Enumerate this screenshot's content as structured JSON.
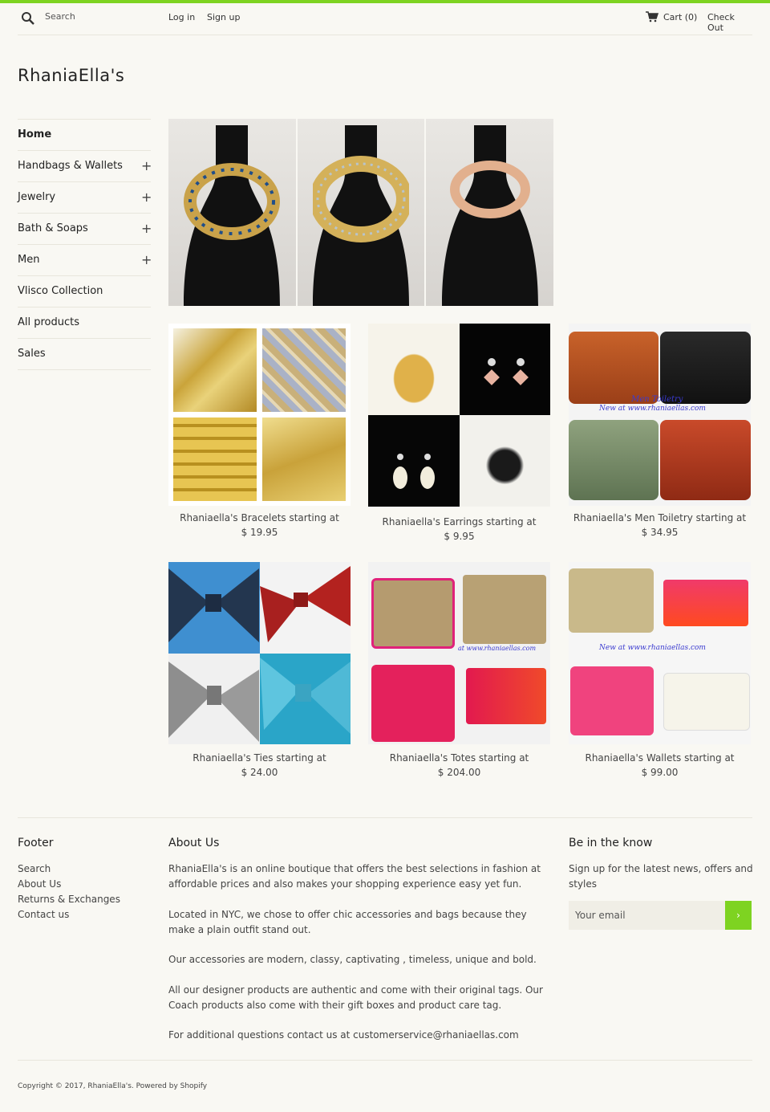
{
  "header": {
    "search_label": "Search",
    "login_label": "Log in",
    "signup_label": "Sign up",
    "cart_label": "Cart (0)",
    "checkout_label": "Check Out"
  },
  "brand": {
    "logo_text": "RhaniaElla's",
    "accent_color": "#7ed321"
  },
  "sidebar": {
    "items": [
      {
        "label": "Home",
        "expandable": false
      },
      {
        "label": "Handbags & Wallets",
        "expandable": true
      },
      {
        "label": "Jewelry",
        "expandable": true
      },
      {
        "label": "Bath & Soaps",
        "expandable": true
      },
      {
        "label": "Men",
        "expandable": true
      },
      {
        "label": "Vlisco Collection",
        "expandable": false
      },
      {
        "label": "All products",
        "expandable": false
      },
      {
        "label": "Sales",
        "expandable": false
      }
    ],
    "expand_symbol": "+"
  },
  "products": [
    {
      "title": "Rhaniaella's Bracelets starting at",
      "price": "$ 19.95"
    },
    {
      "title": "Rhaniaella's Earrings starting at",
      "price": "$ 9.95"
    },
    {
      "title": "Rhaniaella's Men Toiletry starting at",
      "price": "$ 34.95"
    },
    {
      "title": "Rhaniaella's Ties starting at",
      "price": "$ 24.00"
    },
    {
      "title": "Rhaniaella's Totes starting at",
      "price": "$ 204.00"
    },
    {
      "title": "Rhaniaella's Wallets starting at",
      "price": "$ 99.00"
    }
  ],
  "image_text": {
    "toiletry_caption_1": "Men Toiletry",
    "toiletry_caption_2": "New at www.rhaniaellas.com",
    "totes_caption": "at www.rhaniaellas.com",
    "wallets_caption": "New at www.rhaniaellas.com"
  },
  "footer": {
    "col1_title": "Footer",
    "links": [
      "Search",
      "About Us",
      "Returns & Exchanges",
      "Contact us"
    ],
    "col2_title": "About Us",
    "about_paragraphs": [
      "RhaniaElla's is an online boutique that offers the best selections in fashion at affordable prices and also makes your shopping experience easy yet fun.",
      "Located in NYC, we chose to offer chic accessories and bags because they make a plain outfit stand out.",
      "Our accessories are modern, classy, captivating , timeless, unique and bold.",
      "All our designer products are authentic and come with their original tags. Our Coach products also come with their gift boxes and product care tag.",
      "For additional questions contact us at customerservice@rhaniaellas.com"
    ],
    "col3_title": "Be in the know",
    "newsletter_text": "Sign up for the latest news, offers and styles",
    "email_placeholder": "Your email",
    "submit_symbol": "›",
    "copyright": "Copyright © 2017, RhaniaElla's. Powered by Shopify"
  }
}
